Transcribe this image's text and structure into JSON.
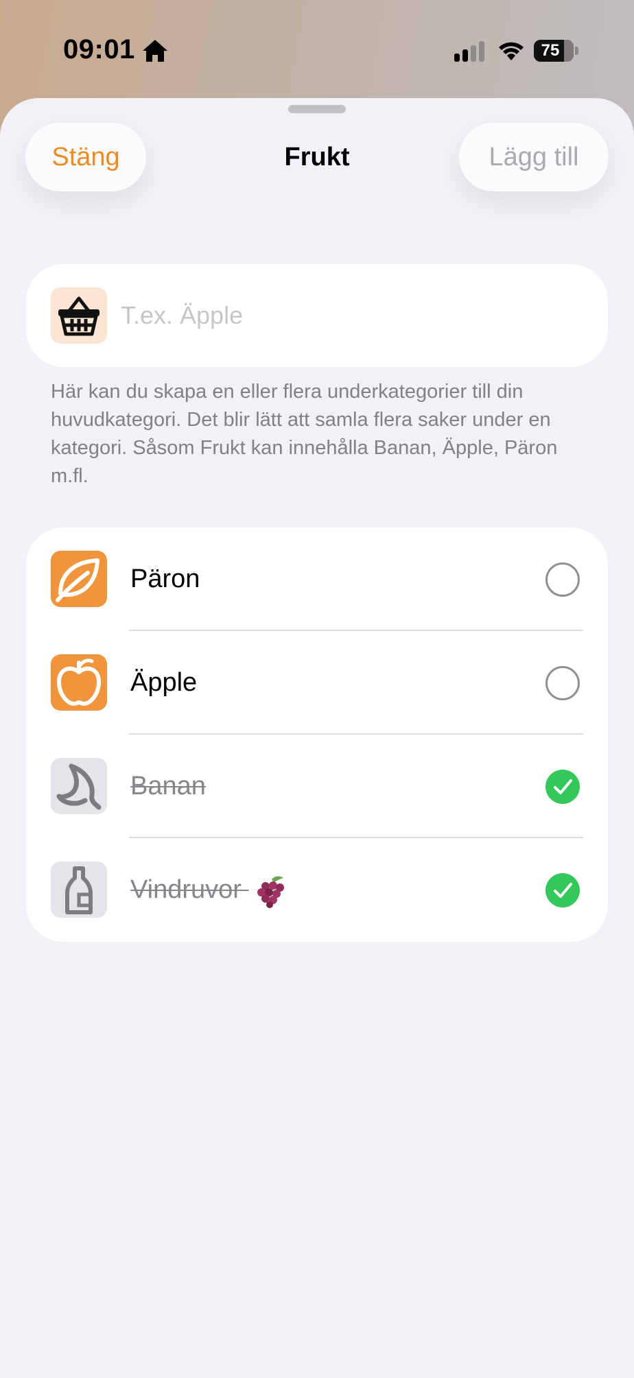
{
  "status_bar": {
    "time": "09:01",
    "battery_percent": "75",
    "icons": [
      "home-icon",
      "signal-icon",
      "wifi-icon",
      "battery-icon"
    ]
  },
  "sheet": {
    "close_label": "Stäng",
    "title": "Frukt",
    "add_label": "Lägg till",
    "accent_color": "#ea8c26"
  },
  "input": {
    "placeholder": "T.ex. Äpple",
    "value": "",
    "icon": "basket-icon"
  },
  "help_text": "Här kan du skapa en eller flera underkategorier till din huvudkategori. Det blir lätt att samla flera saker under en kategori. Såsom Frukt kan innehålla Banan, Äpple, Päron m.fl.",
  "items": [
    {
      "label": "Päron",
      "icon": "leaf-icon",
      "checked": false
    },
    {
      "label": "Äpple",
      "icon": "apple-icon",
      "checked": false
    },
    {
      "label": "Banan",
      "icon": "banana-icon",
      "checked": true
    },
    {
      "label": "Vindruvor",
      "emoji": "grapes-emoji",
      "icon": "bottle-icon",
      "checked": true
    }
  ],
  "colors": {
    "item_tile": "#f0953b",
    "item_tile_done": "#e4e4e9",
    "check": "#34c759"
  }
}
